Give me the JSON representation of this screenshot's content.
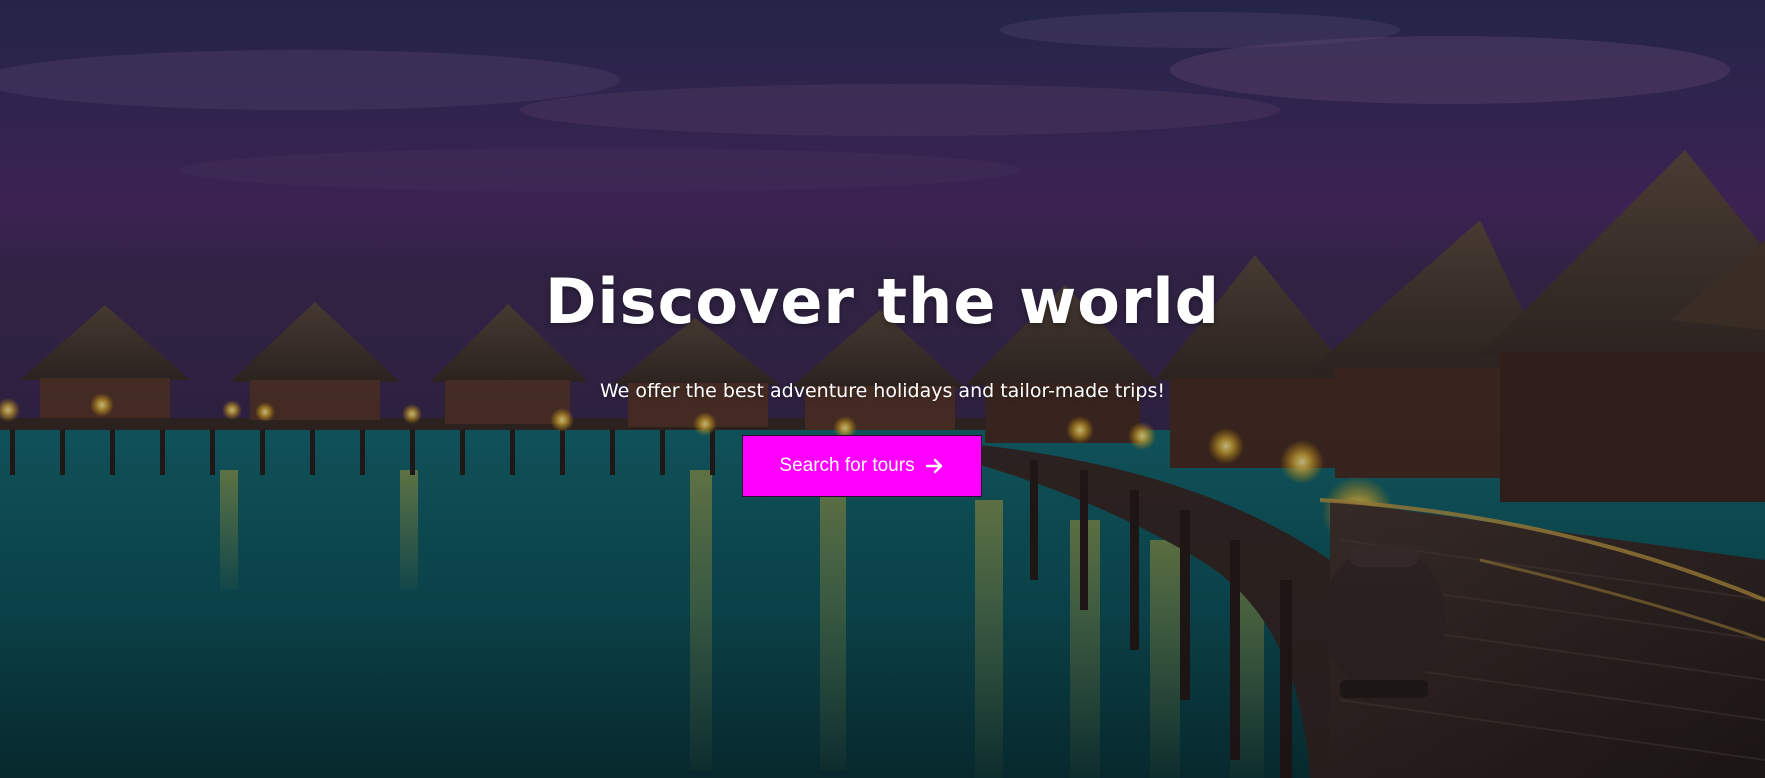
{
  "hero": {
    "title": "Discover the world",
    "subtitle": "We offer the best adventure holidays and tailor-made trips!",
    "cta_label": "Search for tours",
    "cta_icon": "arrow-right-icon",
    "background_image": "overwater-bungalows-at-dusk-photo"
  },
  "colors": {
    "cta_background": "#ff00ff",
    "text": "#ffffff",
    "sky_top": "#2b2a55",
    "sky_mid": "#4a2a66",
    "water": "#0f6f77"
  }
}
